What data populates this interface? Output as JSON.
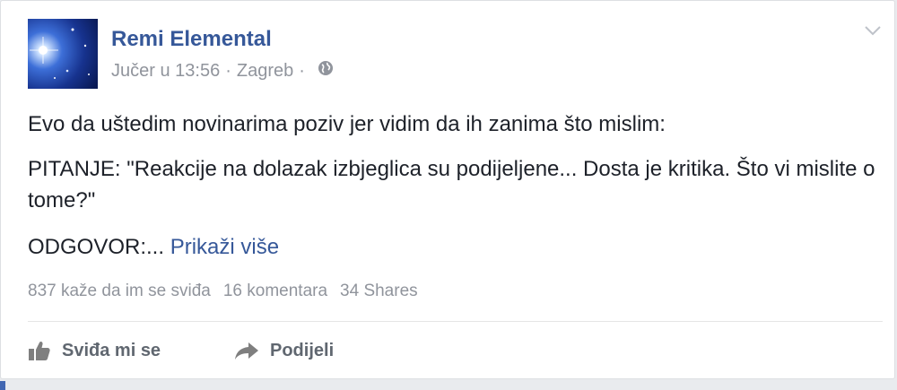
{
  "post": {
    "author": "Remi Elemental",
    "time": "Jučer u 13:56",
    "separator": "·",
    "location": "Zagreb",
    "separator2": "·",
    "paragraph1": "Evo da uštedim novinarima poziv jer vidim da ih zanima što mislim:",
    "paragraph2": "PITANJE: \"Reakcije na dolazak izbjeglica su podijeljene... Dosta je kritika. Što vi mislite o tome?\"",
    "paragraph3": "ODGOVOR:...",
    "see_more": "Prikaži više"
  },
  "stats": {
    "likes": "837 kaže da im se sviđa",
    "comments": "16 komentara",
    "shares": "34 Shares"
  },
  "actions": {
    "like_label": "Sviđa mi se",
    "share_label": "Podijeli"
  },
  "colors": {
    "link": "#365899",
    "meta": "#90949c",
    "text": "#1d2129",
    "accent": "#4267b2"
  },
  "icons": {
    "globe": "globe-icon",
    "chevron": "chevron-down-icon",
    "like": "thumbs-up-icon",
    "share": "share-arrow-icon"
  }
}
